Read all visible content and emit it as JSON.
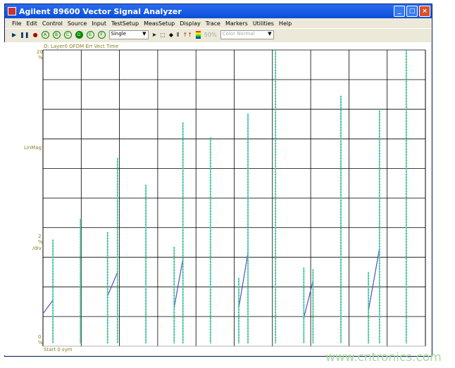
{
  "window": {
    "title": "Agilent 89600 Vector Signal Analyzer",
    "buttons": [
      "_",
      "□",
      "×"
    ]
  },
  "menu": [
    "File",
    "Edit",
    "Control",
    "Source",
    "Input",
    "TestSetup",
    "MeasSetup",
    "Display",
    "Trace",
    "Markers",
    "Utilities",
    "Help"
  ],
  "toolbar": {
    "traces": [
      "A",
      "B",
      "C",
      "D",
      "E",
      "F"
    ],
    "active_trace": "D",
    "mode": "Single",
    "percent": "50%",
    "color_mode": "Color Normal"
  },
  "plot": {
    "trace_title": "D: Layer0 OFDM Err Vect Time",
    "y_top": "20",
    "y_top_unit": "%",
    "y_scale_name": "LinMag",
    "y_div": "2",
    "y_div_unit1": "%",
    "y_div_unit2": "/div",
    "y_bottom": "0",
    "y_bottom_unit": "%",
    "x_start": "Start 0 sym",
    "colors": {
      "stem": "#00d8d8",
      "stem_line": "#a09020",
      "slope": "#5050c0",
      "grid": "#000000"
    }
  },
  "chart_data": {
    "type": "stem",
    "ylim": [
      0,
      20
    ],
    "xdivs": 10,
    "ydivs": 10,
    "stems": [
      {
        "x": 0.26,
        "y": 7.2
      },
      {
        "x": 0.98,
        "y": 8.6
      },
      {
        "x": 1.69,
        "y": 7.7
      },
      {
        "x": 1.95,
        "y": 12.7
      },
      {
        "x": 2.69,
        "y": 10.9
      },
      {
        "x": 3.43,
        "y": 6.7
      },
      {
        "x": 3.66,
        "y": 15.1
      },
      {
        "x": 4.38,
        "y": 14.1
      },
      {
        "x": 5.12,
        "y": 4.6
      },
      {
        "x": 5.36,
        "y": 15.7
      },
      {
        "x": 6.08,
        "y": 20
      },
      {
        "x": 6.82,
        "y": 5.3
      },
      {
        "x": 7.06,
        "y": 5.2
      },
      {
        "x": 7.79,
        "y": 16.9
      },
      {
        "x": 8.51,
        "y": 5.0
      },
      {
        "x": 8.8,
        "y": 15.9
      },
      {
        "x": 9.5,
        "y": 20
      }
    ],
    "slopes": [
      [
        0,
        2.2,
        0.26,
        3.1
      ],
      [
        1.69,
        3.4,
        1.95,
        5.0
      ],
      [
        3.43,
        2.6,
        3.66,
        5.9
      ],
      [
        5.12,
        2.6,
        5.36,
        6.3
      ],
      [
        6.82,
        1.9,
        7.06,
        4.4
      ],
      [
        8.51,
        2.4,
        8.8,
        6.6
      ]
    ]
  },
  "watermark": "www.cntronics.com"
}
